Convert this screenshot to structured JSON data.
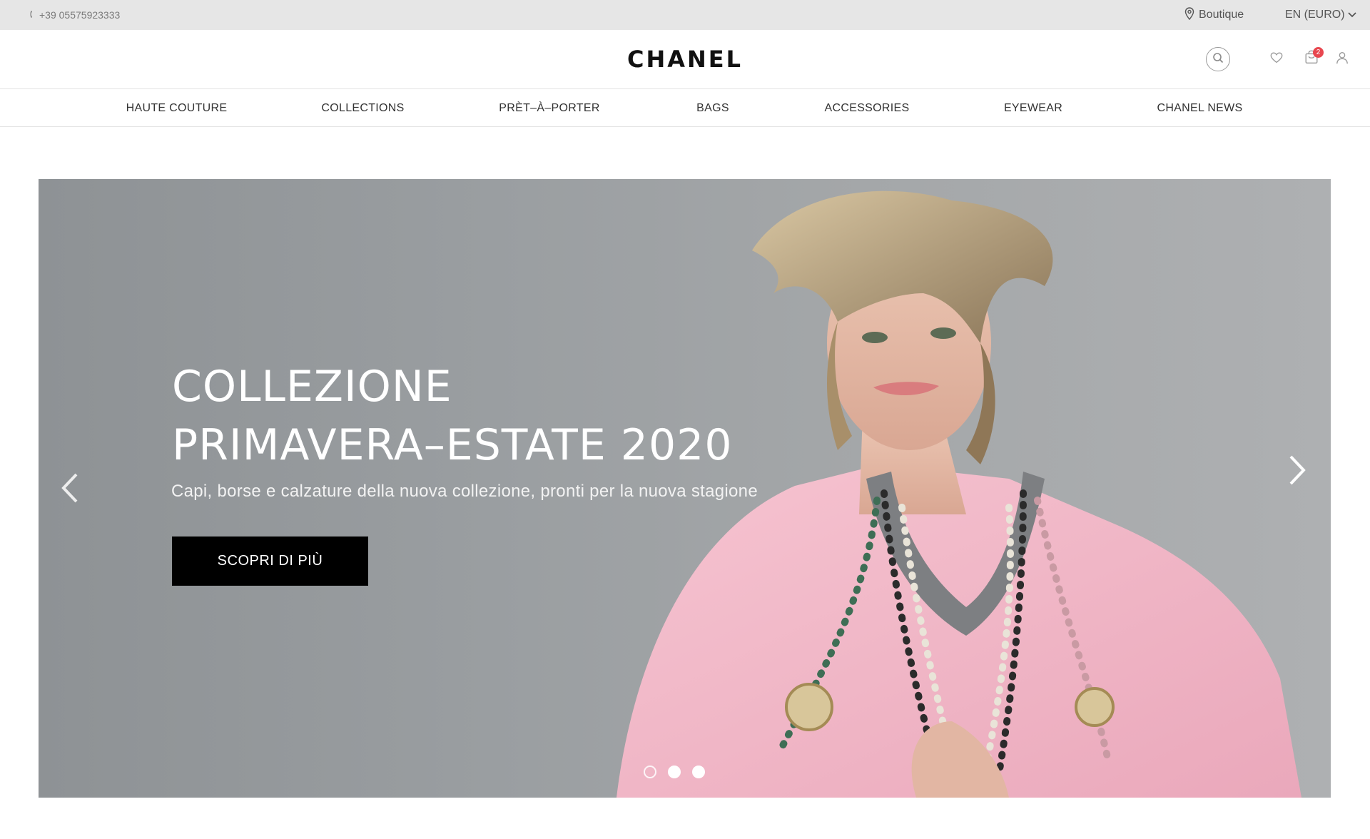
{
  "topbar": {
    "phone": "+39 05575923333",
    "boutique_label": "Boutique",
    "language_label": "EN (EURO)"
  },
  "header": {
    "logo_text": "CHANEL",
    "cart_count": "2"
  },
  "nav": {
    "items": [
      {
        "label": "HAUTE COUTURE"
      },
      {
        "label": "COLLECTIONS"
      },
      {
        "label": "PRÈT–À–PORTER"
      },
      {
        "label": "BAGS"
      },
      {
        "label": "ACCESSORIES"
      },
      {
        "label": "EYEWEAR"
      },
      {
        "label": "CHANEL NEWS"
      }
    ]
  },
  "hero": {
    "title_line1": "COLLEZIONE",
    "title_line2": "PRIMAVERA–ESTATE 2020",
    "subtitle": "Capi, borse e calzature della nuova collezione, pronti per la nuova stagione",
    "cta_label": "SCOPRI DI PIÙ",
    "slides_total": 3,
    "active_slide": 1,
    "image_description": "model-in-pink-jacket-with-pearl-necklaces"
  },
  "colors": {
    "topbar_bg": "#e6e6e6",
    "hero_bg": "#9a9ea1",
    "cta_bg": "#000000",
    "badge": "#e8474f",
    "jacket_pink": "#f2b9c8"
  },
  "icons": {
    "phone": "phone-icon",
    "boutique": "location-pin-icon",
    "language": "chevron-down-icon",
    "search": "search-icon",
    "wishlist": "heart-icon",
    "cart": "shopping-bag-icon",
    "account": "user-icon",
    "prev": "chevron-left-icon",
    "next": "chevron-right-icon"
  }
}
